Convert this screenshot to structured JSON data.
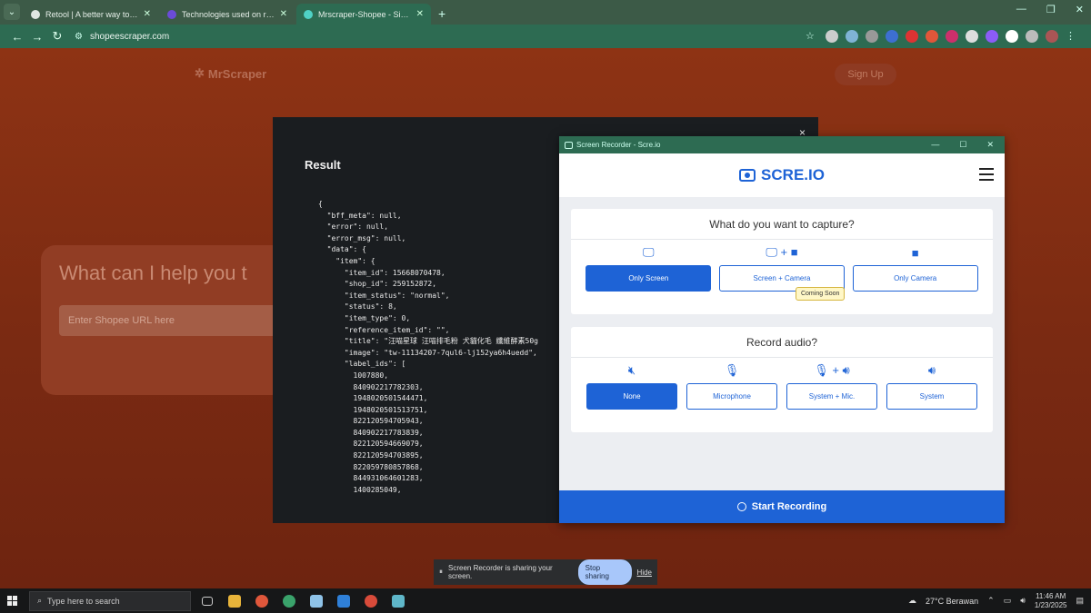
{
  "browser": {
    "tabs": [
      {
        "title": "Retool | A better way to build c",
        "color": "#dfe6e2"
      },
      {
        "title": "Technologies used on retool.co",
        "color": "#6b4bd8"
      },
      {
        "title": "Mrscraper-Shopee - Simplifies",
        "color": "#4fd1c5"
      }
    ],
    "url": "shopeescraper.com"
  },
  "page": {
    "brand": "MrScraper",
    "signup": "Sign Up",
    "hero_text": "What can I help you t",
    "input_placeholder": "Enter Shopee URL here"
  },
  "modal": {
    "close": "×",
    "title": "Result",
    "json_lines": [
      "{",
      "  \"bff_meta\": null,",
      "  \"error\": null,",
      "  \"error_msg\": null,",
      "  \"data\": {",
      "    \"item\": {",
      "      \"item_id\": 15668070478,",
      "      \"shop_id\": 259152872,",
      "      \"item_status\": \"normal\",",
      "      \"status\": 8,",
      "      \"item_type\": 0,",
      "      \"reference_item_id\": \"\",",
      "      \"title\": \"汪喵星球 汪喵排毛粉 犬貓化毛 纖維酵素50g",
      "      \"image\": \"tw-11134207-7qul6-lj152ya6h4uedd\",",
      "      \"label_ids\": [",
      "        1007880,",
      "        840902217782303,",
      "        1948020501544471,",
      "        1948020501513751,",
      "        822120594705943,",
      "        840902217783839,",
      "        822120594669079,",
      "        822120594703895,",
      "        822059780857868,",
      "        844931064601283,",
      "        1400285049,"
    ]
  },
  "recorder": {
    "window_title": "Screen Recorder - Scre.io",
    "logo": "SCRE.IO",
    "capture_question": "What do you want to capture?",
    "capture_options": [
      {
        "label": "Only Screen",
        "icon": "monitor-icon",
        "selected": true
      },
      {
        "label": "Screen + Camera",
        "icon": "monitor-plus-camera-icon",
        "selected": false
      },
      {
        "label": "Only Camera",
        "icon": "camera-icon",
        "selected": false
      }
    ],
    "coming_soon": "Coming Soon",
    "audio_question": "Record audio?",
    "audio_options": [
      {
        "label": "None",
        "icon": "mute-icon",
        "selected": true
      },
      {
        "label": "Microphone",
        "icon": "microphone-icon",
        "selected": false
      },
      {
        "label": "System + Mic.",
        "icon": "mic-plus-speaker-icon",
        "selected": false
      },
      {
        "label": "System",
        "icon": "speaker-icon",
        "selected": false
      }
    ],
    "start": "Start Recording",
    "accent": "#1e63d6"
  },
  "sharebar": {
    "message": "Screen Recorder is sharing your screen.",
    "stop": "Stop sharing",
    "hide": "Hide"
  },
  "taskbar": {
    "search": "Type here to search",
    "weather": "27°C  Berawan",
    "time": "11:46 AM",
    "date": "1/23/2025"
  }
}
